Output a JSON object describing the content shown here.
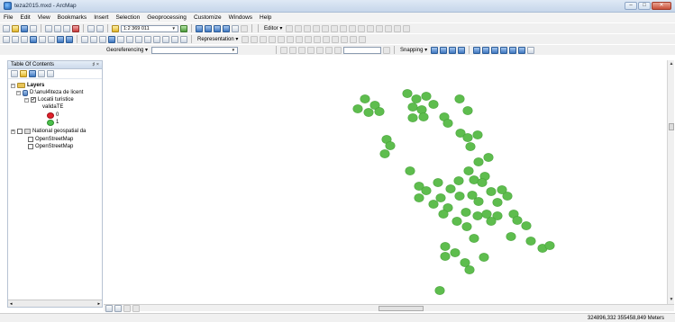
{
  "window": {
    "title": "teza2015.mxd - ArcMap",
    "buttons": [
      "–",
      "□",
      "✕"
    ]
  },
  "menu": [
    "File",
    "Edit",
    "View",
    "Bookmarks",
    "Insert",
    "Selection",
    "Geoprocessing",
    "Customize",
    "Windows",
    "Help"
  ],
  "toolbar": {
    "scale": "1:2 369 011",
    "editor_label": "Editor ▾",
    "representation_label": "Representation ▾",
    "georeferencing_label": "Georeferencing ▾",
    "snapping_label": "Snapping ▾"
  },
  "toc": {
    "title": "Table Of Contents",
    "controls": "♯ ×",
    "layers_label": "Layers",
    "path_label": "D:\\anul4\\teza de licent",
    "layer_label": "Locatii turistice",
    "field_label": "validaTE",
    "legend": [
      {
        "value": "0",
        "color": "#e0202a"
      },
      {
        "value": "1",
        "color": "#4cc04c"
      }
    ],
    "group_label": "National geospatial da",
    "basemaps": [
      "OpenStreetMap",
      "OpenStreetMap"
    ]
  },
  "map": {
    "point_color": "#5ebd4e",
    "points": [
      [
        405,
        110
      ],
      [
        416,
        117
      ],
      [
        397,
        121
      ],
      [
        409,
        125
      ],
      [
        421,
        124
      ],
      [
        452,
        104
      ],
      [
        462,
        110
      ],
      [
        473,
        107
      ],
      [
        458,
        119
      ],
      [
        468,
        122
      ],
      [
        481,
        116
      ],
      [
        470,
        130
      ],
      [
        458,
        131
      ],
      [
        493,
        130
      ],
      [
        497,
        137
      ],
      [
        510,
        110
      ],
      [
        519,
        123
      ],
      [
        511,
        148
      ],
      [
        519,
        153
      ],
      [
        530,
        150
      ],
      [
        522,
        163
      ],
      [
        531,
        180
      ],
      [
        542,
        175
      ],
      [
        429,
        155
      ],
      [
        433,
        162
      ],
      [
        427,
        171
      ],
      [
        455,
        190
      ],
      [
        465,
        207
      ],
      [
        473,
        212
      ],
      [
        465,
        220
      ],
      [
        486,
        203
      ],
      [
        489,
        220
      ],
      [
        500,
        210
      ],
      [
        509,
        201
      ],
      [
        520,
        190
      ],
      [
        526,
        200
      ],
      [
        538,
        196
      ],
      [
        545,
        213
      ],
      [
        552,
        225
      ],
      [
        563,
        218
      ],
      [
        552,
        240
      ],
      [
        545,
        246
      ],
      [
        510,
        218
      ],
      [
        517,
        236
      ],
      [
        530,
        240
      ],
      [
        518,
        252
      ],
      [
        526,
        265
      ],
      [
        540,
        238
      ],
      [
        557,
        211
      ],
      [
        524,
        217
      ],
      [
        531,
        224
      ],
      [
        535,
        203
      ],
      [
        497,
        231
      ],
      [
        507,
        246
      ],
      [
        481,
        227
      ],
      [
        492,
        238
      ],
      [
        570,
        238
      ],
      [
        574,
        245
      ],
      [
        584,
        251
      ],
      [
        567,
        263
      ],
      [
        589,
        268
      ],
      [
        602,
        276
      ],
      [
        610,
        273
      ],
      [
        494,
        274
      ],
      [
        505,
        281
      ],
      [
        494,
        285
      ],
      [
        516,
        292
      ],
      [
        537,
        286
      ],
      [
        521,
        300
      ],
      [
        488,
        323
      ]
    ]
  },
  "status": {
    "coordinates": "324896,332  355458,849 Meters"
  }
}
